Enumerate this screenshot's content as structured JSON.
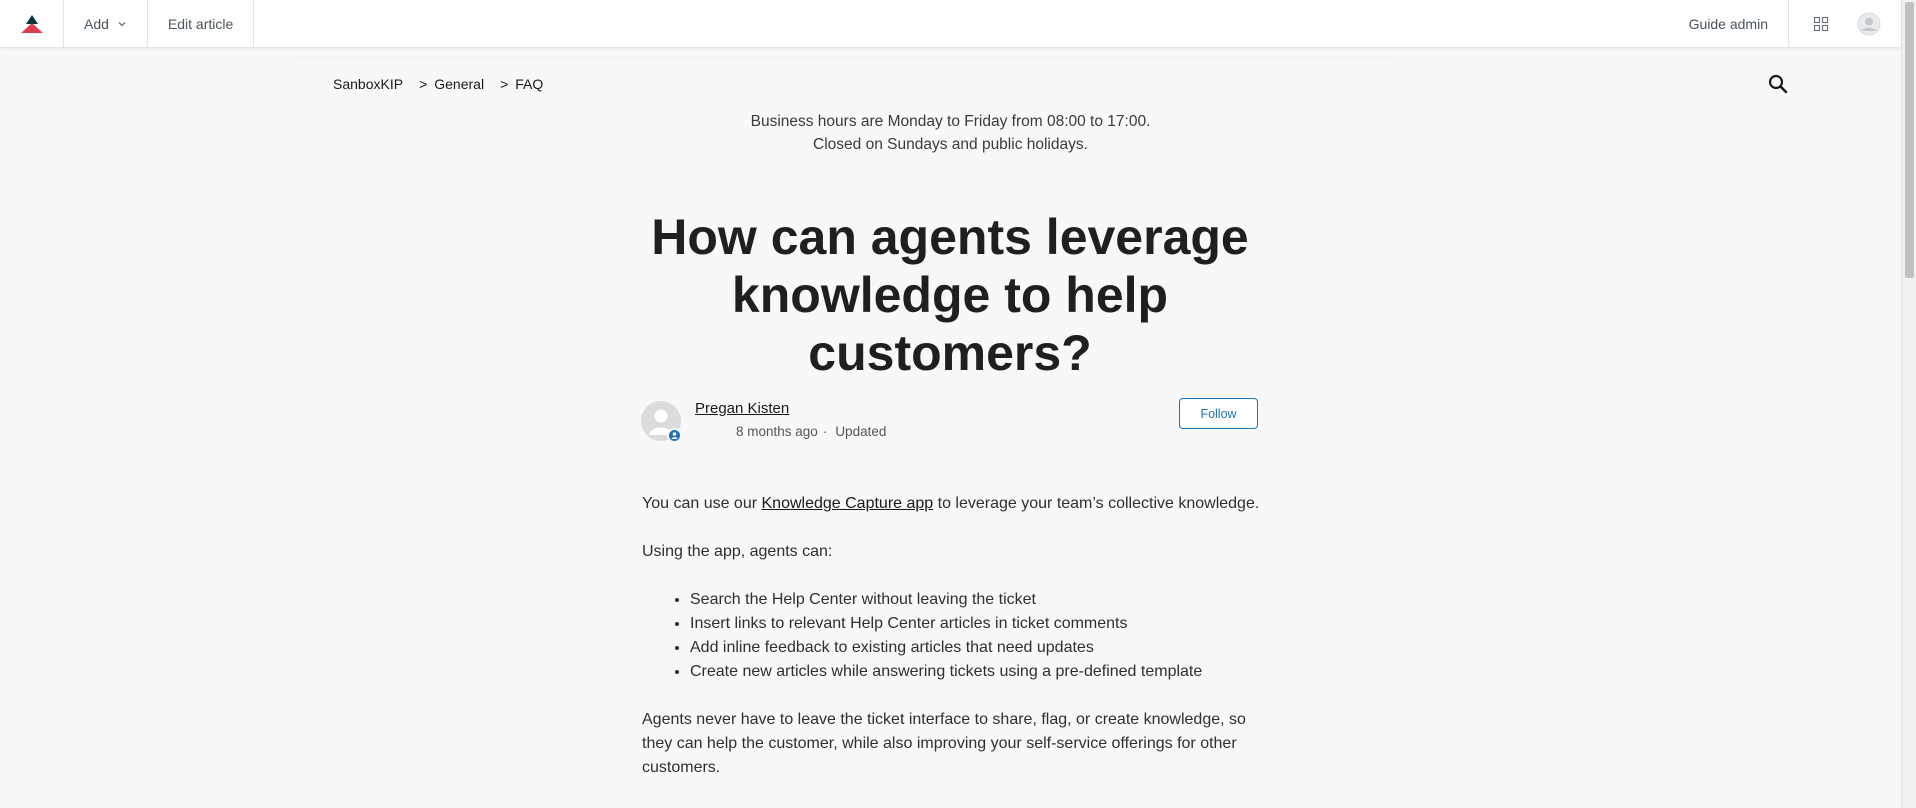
{
  "topbar": {
    "add_label": "Add",
    "edit_label": "Edit article",
    "guide_admin_label": "Guide admin"
  },
  "breadcrumbs": [
    "SanboxKIP",
    "General",
    "FAQ"
  ],
  "breadcrumb_separator": ">",
  "notice": {
    "line1": "Business hours are Monday to Friday from 08:00 to 17:00.",
    "line2": "Closed on Sundays and public holidays."
  },
  "article": {
    "title": "How can agents leverage knowledge to help customers?",
    "author_name": "Pregan Kisten",
    "time_ago": "8 months ago",
    "dot": "·",
    "updated_label": "Updated",
    "follow_label": "Follow",
    "p1_before": "You can use our ",
    "p1_link": "Knowledge Capture app",
    "p1_after": " to leverage your team’s collective knowledge.",
    "p2": "Using the app, agents can:",
    "bullets": [
      "Search the Help Center without leaving the ticket",
      "Insert links to relevant Help Center articles in ticket comments",
      "Add inline feedback to existing articles that need updates",
      "Create new articles while answering tickets using a pre-defined template"
    ],
    "p3": "Agents never have to leave the ticket interface to share, flag, or create knowledge, so they can help the customer, while also improving your self-service offerings for other customers."
  },
  "colors": {
    "brand_red": "#d93f4c",
    "brand_navy": "#03363d",
    "accent_blue": "#1f73b7",
    "page_bg": "#f8f8f8"
  },
  "icons": [
    "zendesk-logo-icon",
    "chevron-down-icon",
    "product-tray-icon",
    "user-avatar-icon",
    "search-icon",
    "agent-badge-icon"
  ]
}
